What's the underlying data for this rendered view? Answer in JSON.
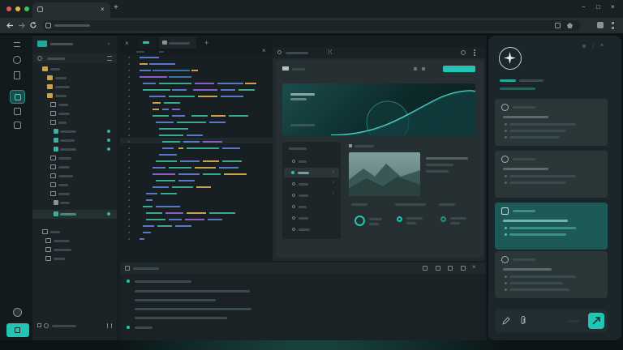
{
  "window": {
    "controls": [
      "−",
      "□",
      "×"
    ],
    "new_tab": "+",
    "tab_close": "×"
  },
  "colors": {
    "accent": "#22c4b4",
    "background": "#0c1416",
    "panel": "#1b2326",
    "card_active": "#1d5a57"
  },
  "icons": {
    "back": "arrow-left-icon",
    "forward": "arrow-right-icon",
    "reload": "reload-icon",
    "sparkle": "sparkle-icon",
    "send": "send-icon",
    "pen": "pen-icon",
    "attach": "paperclip-icon"
  }
}
